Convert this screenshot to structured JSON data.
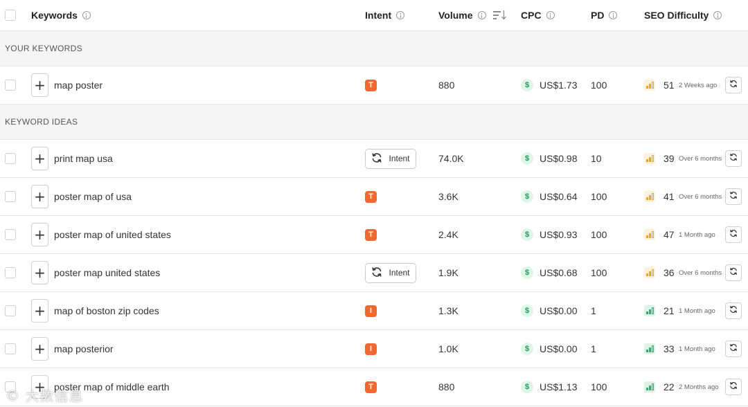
{
  "header": {
    "keywords": "Keywords",
    "intent": "Intent",
    "volume": "Volume",
    "cpc": "CPC",
    "pd": "PD",
    "seo_difficulty": "SEO Difficulty"
  },
  "sections": {
    "your_keywords": "YOUR KEYWORDS",
    "keyword_ideas": "KEYWORD IDEAS"
  },
  "intent_button_label": "Intent",
  "colors": {
    "intent_badge": "#f2662f",
    "kd_medium": "#f0a31c",
    "kd_easy": "#23b26d",
    "dollar": "#1f9c5a"
  },
  "your_keywords": [
    {
      "keyword": "map poster",
      "intent": "T",
      "volume": "880",
      "cpc": "US$1.73",
      "pd": "100",
      "kd": "51",
      "kd_level": "medium",
      "updated": "2 Weeks ago"
    }
  ],
  "keyword_ideas": [
    {
      "keyword": "print map usa",
      "intent": "",
      "volume": "74.0K",
      "cpc": "US$0.98",
      "pd": "10",
      "kd": "39",
      "kd_level": "medium",
      "updated": "Over 6 months"
    },
    {
      "keyword": "poster map of usa",
      "intent": "T",
      "volume": "3.6K",
      "cpc": "US$0.64",
      "pd": "100",
      "kd": "41",
      "kd_level": "medium",
      "updated": "Over 6 months"
    },
    {
      "keyword": "poster map of united states",
      "intent": "T",
      "volume": "2.4K",
      "cpc": "US$0.93",
      "pd": "100",
      "kd": "47",
      "kd_level": "medium",
      "updated": "1 Month ago"
    },
    {
      "keyword": "poster map united states",
      "intent": "",
      "volume": "1.9K",
      "cpc": "US$0.68",
      "pd": "100",
      "kd": "36",
      "kd_level": "medium",
      "updated": "Over 6 months"
    },
    {
      "keyword": "map of boston zip codes",
      "intent": "I",
      "volume": "1.3K",
      "cpc": "US$0.00",
      "pd": "1",
      "kd": "21",
      "kd_level": "easy",
      "updated": "1 Month ago"
    },
    {
      "keyword": "map posterior",
      "intent": "I",
      "volume": "1.0K",
      "cpc": "US$0.00",
      "pd": "1",
      "kd": "33",
      "kd_level": "easy",
      "updated": "1 Month ago"
    },
    {
      "keyword": "poster map of middle earth",
      "intent": "T",
      "volume": "880",
      "cpc": "US$1.13",
      "pd": "100",
      "kd": "22",
      "kd_level": "easy",
      "updated": "2 Months ago"
    }
  ],
  "watermark": "大数信息"
}
